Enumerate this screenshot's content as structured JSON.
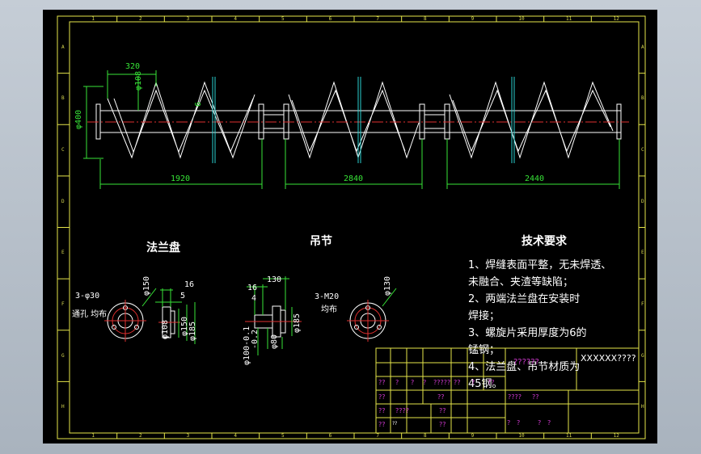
{
  "colors": {
    "frame": "#e6e64a",
    "shaft": "#ffffff",
    "center_line": "#e03030",
    "dimension": "#37e337",
    "flange": "#2ad0d0",
    "table_text": "#d23ad2",
    "background": "#000000"
  },
  "border": {
    "col_marks": [
      "1",
      "2",
      "3",
      "4",
      "5",
      "6",
      "7",
      "8",
      "9",
      "10",
      "11",
      "12"
    ],
    "row_marks": [
      "A",
      "B",
      "C",
      "D",
      "E",
      "F",
      "G",
      "H"
    ]
  },
  "main_view": {
    "dimensions": {
      "pitch": "320",
      "flight_dia": "φ108",
      "outer_dia": "φ400",
      "gap": "6",
      "len1": "1920",
      "len2": "2840",
      "len3": "2440"
    }
  },
  "flange_view": {
    "title": "法兰盘",
    "holes": "3-φ30",
    "holes_note": "通孔 均布",
    "pcd": "φ150",
    "thk1": "16",
    "thk2": "5",
    "d1": "φ108",
    "d2": "φ150",
    "d3": "φ185"
  },
  "hanger_view": {
    "title": "吊节",
    "holes": "3-M20",
    "holes_note": "均布",
    "pcd": "φ130",
    "w1": "16",
    "w2": "130",
    "w3": "4",
    "d1": "φ100-0.1",
    "d1b": "-0.2",
    "d2": "φ80",
    "d3": "φ185"
  },
  "tech_requirements": {
    "title": "技术要求",
    "lines": [
      "1、焊缝表面平整，无未焊透、",
      "未融合、夹渣等缺陷；",
      "2、两端法兰盘在安装时",
      "焊接；",
      "3、螺旋片采用厚度为6的",
      "锰钢；",
      "4、法兰盘、吊节材质为",
      "45钢。"
    ]
  },
  "title_block": {
    "name": "??????",
    "drawing_no": "XXXXXX????",
    "row_a": [
      "??",
      "?",
      "?",
      "?",
      "?????",
      "??",
      "?",
      "??"
    ],
    "row_b": [
      "??",
      "??",
      "????",
      "??"
    ],
    "row_c": [
      "??",
      "????",
      "??"
    ],
    "row_d": [
      "??",
      "?",
      "?",
      "??",
      "?",
      "?"
    ],
    "stamp": "??"
  }
}
